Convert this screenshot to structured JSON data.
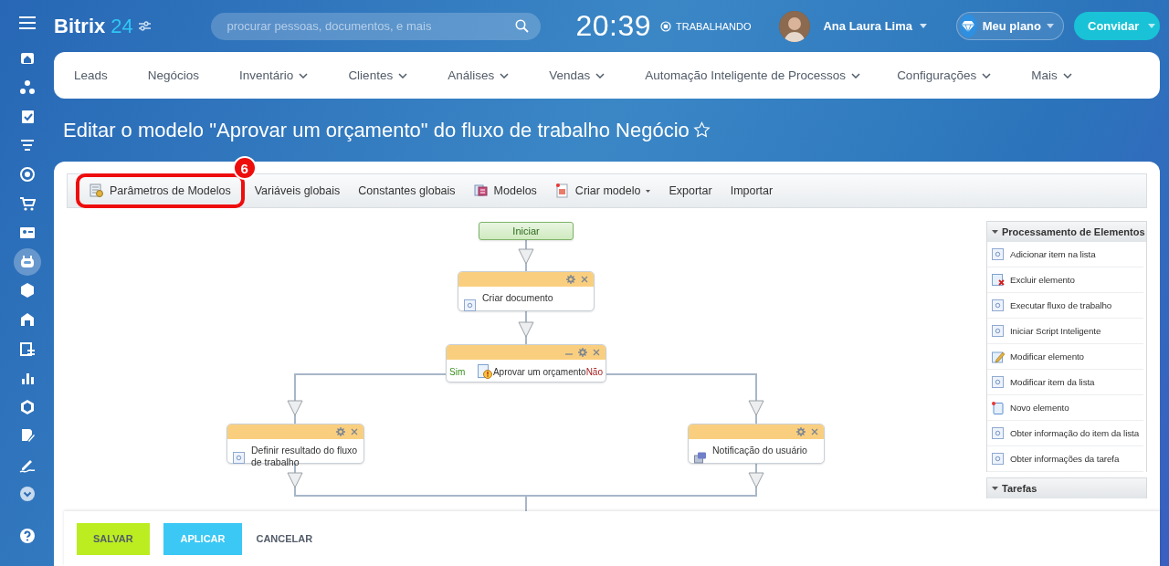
{
  "header": {
    "logo_main": "Bitrix",
    "logo_number": "24",
    "search": {
      "placeholder": "procurar pessoas, documentos, e mais"
    },
    "clock": "20:39",
    "work_status": "TRABALHANDO",
    "user_name": "Ana Laura Lima",
    "plan_button": "Meu plano",
    "invite_button": "Convidar"
  },
  "sidebar": {
    "items": [
      {
        "selected": false
      },
      {
        "selected": false
      },
      {
        "selected": false
      },
      {
        "selected": false
      },
      {
        "selected": false
      },
      {
        "selected": false
      },
      {
        "selected": false
      },
      {
        "selected": true
      },
      {
        "selected": false
      },
      {
        "selected": false
      },
      {
        "selected": false
      },
      {
        "selected": false
      },
      {
        "selected": false
      },
      {
        "selected": false
      },
      {
        "selected": false
      },
      {
        "selected": false
      }
    ]
  },
  "nav": {
    "items": [
      {
        "label": "Leads",
        "dropdown": false
      },
      {
        "label": "Negócios",
        "dropdown": false
      },
      {
        "label": "Inventário",
        "dropdown": true
      },
      {
        "label": "Clientes",
        "dropdown": true
      },
      {
        "label": "Análises",
        "dropdown": true
      },
      {
        "label": "Vendas",
        "dropdown": true
      },
      {
        "label": "Automação Inteligente de Processos",
        "dropdown": true
      },
      {
        "label": "Configurações",
        "dropdown": true
      },
      {
        "label": "Mais",
        "dropdown": true
      }
    ]
  },
  "page_title": "Editar o modelo \"Aprovar um orçamento\" do fluxo de trabalho Negócio",
  "toolbar": {
    "items": [
      {
        "label": "Parâmetros de Modelos",
        "kind": "params",
        "callout": "6"
      },
      {
        "label": "Variáveis globais",
        "kind": "plain"
      },
      {
        "label": "Constantes globais",
        "kind": "plain"
      },
      {
        "label": "Modelos",
        "kind": "models"
      },
      {
        "label": "Criar modelo",
        "kind": "create",
        "dropdown": true
      },
      {
        "label": "Exportar",
        "kind": "plain"
      },
      {
        "label": "Importar",
        "kind": "plain"
      }
    ]
  },
  "workflow": {
    "nodes": [
      {
        "kind": "start",
        "label": "Iniciar"
      },
      {
        "kind": "activity",
        "label": "Criar documento"
      },
      {
        "kind": "condition",
        "label": "Aprovar um orçamento",
        "yes_label": "Sim",
        "no_label": "Não"
      },
      {
        "kind": "activity",
        "label": "Definir resultado do fluxo de trabalho"
      },
      {
        "kind": "message",
        "label": "Notificação do usuário"
      }
    ]
  },
  "activity_panel": {
    "sections": [
      {
        "title": "Processamento de Elementos",
        "expanded": true,
        "items": [
          {
            "label": "Adicionar item na lista",
            "kind": "generic"
          },
          {
            "label": "Excluir elemento",
            "kind": "delete"
          },
          {
            "label": "Executar fluxo de trabalho",
            "kind": "generic"
          },
          {
            "label": "Iniciar Script Inteligente",
            "kind": "generic"
          },
          {
            "label": "Modificar elemento",
            "kind": "edit"
          },
          {
            "label": "Modificar item da lista",
            "kind": "generic"
          },
          {
            "label": "Novo elemento",
            "kind": "new"
          },
          {
            "label": "Obter informação do item da lista",
            "kind": "generic"
          },
          {
            "label": "Obter informações da tarefa",
            "kind": "generic"
          }
        ]
      },
      {
        "title": "Tarefas",
        "expanded": true
      }
    ]
  },
  "footer": {
    "buttons": [
      {
        "label": "SALVAR",
        "kind": "save"
      },
      {
        "label": "APLICAR",
        "kind": "apply"
      },
      {
        "label": "CANCELAR",
        "kind": "cancel"
      }
    ]
  }
}
